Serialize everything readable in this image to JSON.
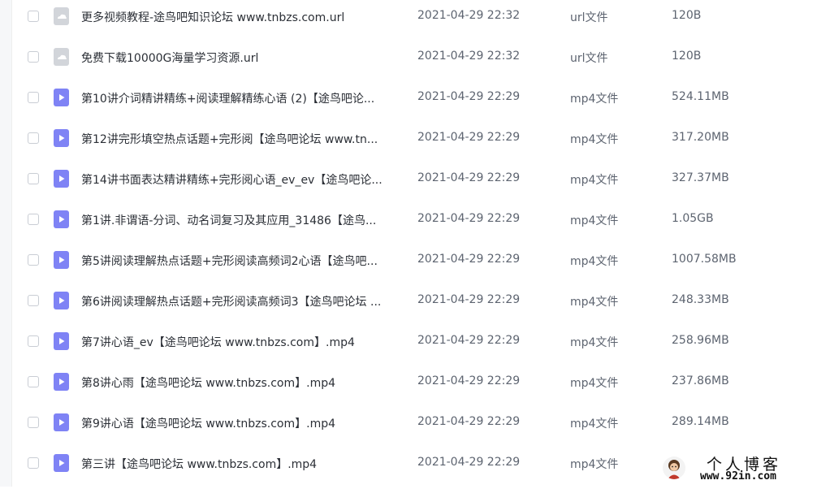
{
  "files": [
    {
      "name": "更多视频教程-途鸟吧知识论坛 www.tnbzs.com.url",
      "date": "2021-04-29 22:32",
      "type": "url文件",
      "size": "120B",
      "icon": "url-file-icon"
    },
    {
      "name": "免费下载10000G海量学习资源.url",
      "date": "2021-04-29 22:32",
      "type": "url文件",
      "size": "120B",
      "icon": "url-file-icon"
    },
    {
      "name": "第10讲介词精讲精练+阅读理解精练心语 (2)【途鸟吧论...",
      "date": "2021-04-29 22:29",
      "type": "mp4文件",
      "size": "524.11MB",
      "icon": "video-file-icon"
    },
    {
      "name": "第12讲完形填空热点话题+完形阅【途鸟吧论坛 www.tn...",
      "date": "2021-04-29 22:29",
      "type": "mp4文件",
      "size": "317.20MB",
      "icon": "video-file-icon"
    },
    {
      "name": "第14讲书面表达精讲精练+完形阅心语_ev_ev【途鸟吧论...",
      "date": "2021-04-29 22:29",
      "type": "mp4文件",
      "size": "327.37MB",
      "icon": "video-file-icon"
    },
    {
      "name": "第1讲.非谓语-分词、动名词复习及其应用_31486【途鸟...",
      "date": "2021-04-29 22:29",
      "type": "mp4文件",
      "size": "1.05GB",
      "icon": "video-file-icon"
    },
    {
      "name": "第5讲阅读理解热点话题+完形阅读高频词2心语【途鸟吧...",
      "date": "2021-04-29 22:29",
      "type": "mp4文件",
      "size": "1007.58MB",
      "icon": "video-file-icon"
    },
    {
      "name": "第6讲阅读理解热点话题+完形阅读高频词3【途鸟吧论坛 ...",
      "date": "2021-04-29 22:29",
      "type": "mp4文件",
      "size": "248.33MB",
      "icon": "video-file-icon"
    },
    {
      "name": "第7讲心语_ev【途鸟吧论坛 www.tnbzs.com】.mp4",
      "date": "2021-04-29 22:29",
      "type": "mp4文件",
      "size": "258.96MB",
      "icon": "video-file-icon"
    },
    {
      "name": "第8讲心雨【途鸟吧论坛 www.tnbzs.com】.mp4",
      "date": "2021-04-29 22:29",
      "type": "mp4文件",
      "size": "237.86MB",
      "icon": "video-file-icon"
    },
    {
      "name": "第9讲心语【途鸟吧论坛 www.tnbzs.com】.mp4",
      "date": "2021-04-29 22:29",
      "type": "mp4文件",
      "size": "289.14MB",
      "icon": "video-file-icon"
    },
    {
      "name": "第三讲【途鸟吧论坛 www.tnbzs.com】.mp4",
      "date": "2021-04-29 22:29",
      "type": "mp4文件",
      "size": "",
      "icon": "video-file-icon"
    }
  ],
  "watermark": {
    "title": "个人博客",
    "url": "www.92in.com"
  },
  "colors": {
    "video_icon": "#7f83f5",
    "url_icon": "#d2d5da",
    "text_primary": "#2b2f36",
    "text_secondary": "#5d6470"
  }
}
